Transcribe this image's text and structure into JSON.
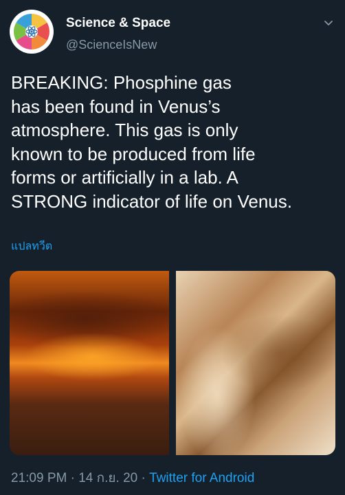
{
  "author": {
    "display_name": "Science & Space",
    "handle": "@ScienceIsNew"
  },
  "tweet": {
    "text": "BREAKING: Phosphine gas\nhas been found in Venus’s\natmosphere. This gas is only\nknown to be produced from life\nforms or artificially in a lab. A\nSTRONG indicator of life on Venus.",
    "translate_label": "แปลทวีต"
  },
  "media": {
    "count": 2
  },
  "meta": {
    "time": "21:09 PM",
    "separator1": " · ",
    "date": "14 ก.ย. 20",
    "separator2": " · ",
    "source": "Twitter for Android"
  },
  "colors": {
    "background": "#15202b",
    "text": "#ffffff",
    "secondary": "#8899a6",
    "accent": "#1da1f2"
  },
  "icons": {
    "menu": "chevron-down-icon",
    "avatar": "science-logo"
  }
}
